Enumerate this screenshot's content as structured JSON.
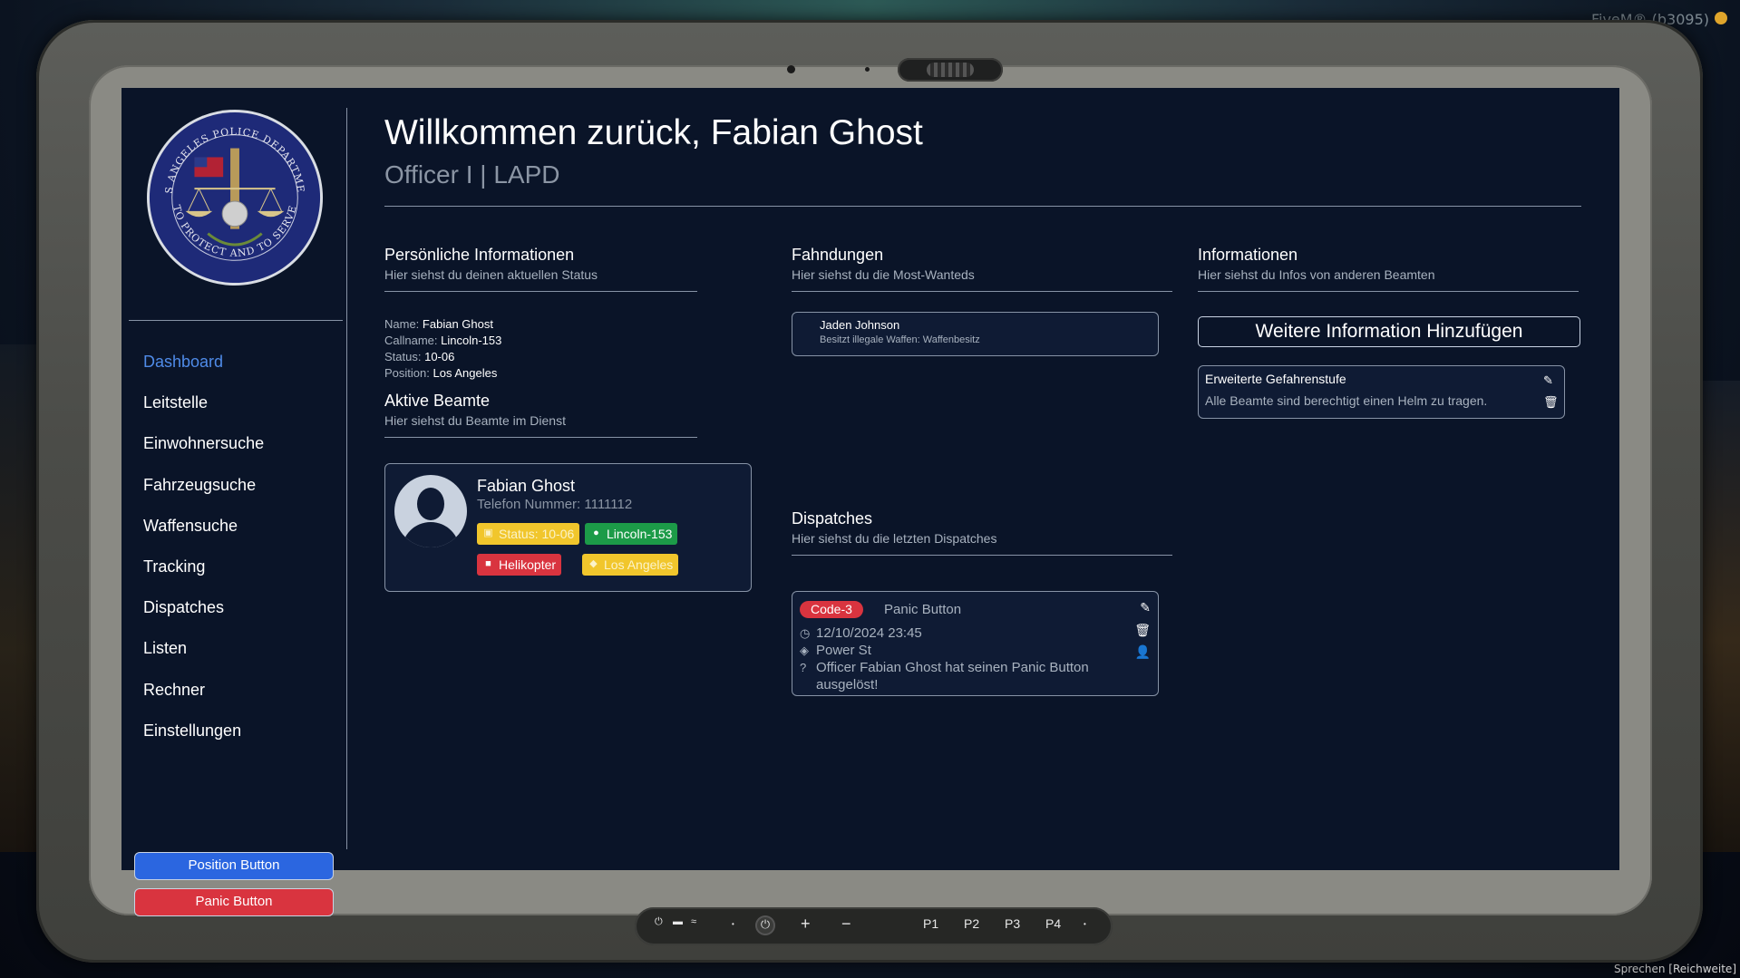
{
  "colors": {
    "screen_bg": "#0a1428",
    "accent_blue": "#2b66e0",
    "nav_active": "#4f8be8",
    "danger_red": "#d9343f",
    "status_yellow": "#f1c62c",
    "success_green": "#1c9b48"
  },
  "overlay": {
    "client_label": "FiveM® (b3095)",
    "voice_label": "Sprechen [Reichweite]"
  },
  "sidebar": {
    "logo_icon": "lapd-badge-logo",
    "logo_text_top": "LOS ANGELES POLICE DEPARTMENT",
    "logo_text_bottom": "TO PROTECT AND TO SERVE",
    "nav": [
      {
        "label": "Dashboard",
        "active": true
      },
      {
        "label": "Leitstelle"
      },
      {
        "label": "Einwohnersuche"
      },
      {
        "label": "Fahrzeugsuche"
      },
      {
        "label": "Waffensuche"
      },
      {
        "label": "Tracking"
      },
      {
        "label": "Dispatches"
      },
      {
        "label": "Listen"
      },
      {
        "label": "Rechner"
      },
      {
        "label": "Einstellungen"
      }
    ],
    "position_button": "Position Button",
    "panic_button": "Panic Button"
  },
  "header": {
    "welcome": "Willkommen zurück, Fabian Ghost",
    "rank": "Officer I | LAPD"
  },
  "personal": {
    "title": "Persönliche Informationen",
    "subtitle": "Hier siehst du deinen aktuellen Status",
    "name_label": "Name:",
    "name": "Fabian Ghost",
    "callname_label": "Callname:",
    "callname": "Lincoln-153",
    "status_label": "Status:",
    "status": "10-06",
    "position_label": "Position:",
    "position": "Los Angeles"
  },
  "active_officers": {
    "title": "Aktive Beamte",
    "subtitle": "Hier siehst du Beamte im Dienst",
    "officers": [
      {
        "name": "Fabian Ghost",
        "phone": "Telefon Nummer: 1111112",
        "status_badge": "Status: 10-06",
        "call_badge": "Lincoln-153",
        "vehicle_badge": "Helikopter",
        "location_badge": "Los Angeles"
      }
    ]
  },
  "wanted": {
    "title": "Fahndungen",
    "subtitle": "Hier siehst du die Most-Wanteds",
    "items": [
      {
        "name": "Jaden Johnson",
        "description": "Besitzt illegale Waffen: Waffenbesitz"
      }
    ]
  },
  "info": {
    "title": "Informationen",
    "subtitle": "Hier siehst du Infos von anderen Beamten",
    "add_button": "Weitere Information Hinzufügen",
    "items": [
      {
        "title": "Erweiterte Gefahrenstufe",
        "description": "Alle Beamte sind berechtigt einen Helm zu tragen."
      }
    ]
  },
  "dispatches": {
    "title": "Dispatches",
    "subtitle": "Hier siehst du die letzten Dispatches",
    "items": [
      {
        "code": "Code-3",
        "type": "Panic Button",
        "time": "12/10/2024 23:45",
        "street": "Power St",
        "message_line1": "Officer Fabian Ghost hat seinen Panic Button",
        "message_line2": "ausgelöst!"
      }
    ]
  },
  "dock": {
    "p1": "P1",
    "p2": "P2",
    "p3": "P3",
    "p4": "P4",
    "plus": "+",
    "minus": "−"
  }
}
